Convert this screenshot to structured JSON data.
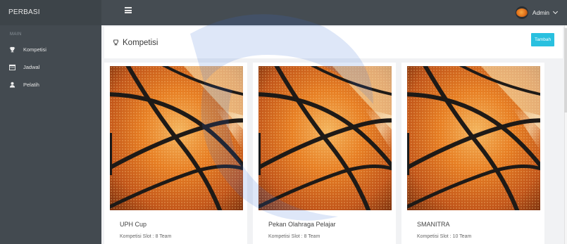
{
  "app": {
    "brand": "PERBASI"
  },
  "topbar": {
    "user_name": "Admin"
  },
  "sidebar": {
    "section_label": "MAIN",
    "items": [
      {
        "label": "Kompetisi",
        "icon": "trophy-icon"
      },
      {
        "label": "Jadwal",
        "icon": "calendar-icon"
      },
      {
        "label": "Pelatih",
        "icon": "user-icon"
      }
    ]
  },
  "main": {
    "title": "Kompetisi",
    "add_button": "Tambah",
    "cards": [
      {
        "title": "UPH Cup",
        "slot": "Kompetisi Slot : 8 Team"
      },
      {
        "title": "Pekan Olahraga Pelajar",
        "slot": "Kompetisi Slot : 8 Team"
      },
      {
        "title": "SMANITRA",
        "slot": "Kompetisi Slot : 10 Team"
      }
    ]
  },
  "colors": {
    "topbar": "#454c52",
    "sidebar": "#434a50",
    "accent_button": "#29c0df",
    "background": "#f1f2f4"
  }
}
